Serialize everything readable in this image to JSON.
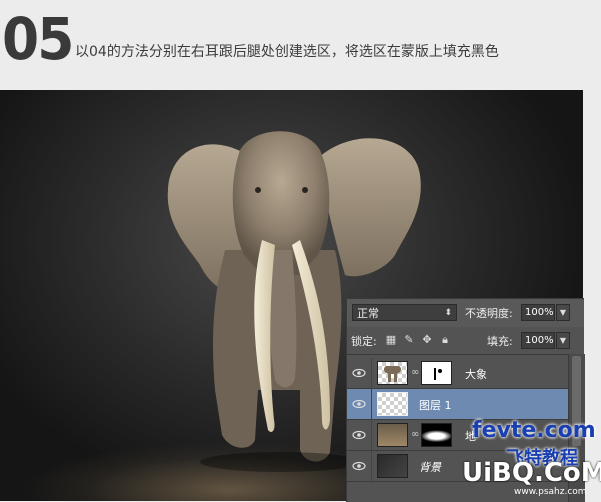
{
  "header": {
    "step_number": "05",
    "instruction": "以04的方法分别在右耳跟后腿处创建选区，将选区在蒙版上填充黑色"
  },
  "layers_panel": {
    "blend_mode": "正常",
    "opacity_label": "不透明度:",
    "opacity_value": "100%",
    "lock_label": "锁定:",
    "fill_label": "填充:",
    "fill_value": "100%",
    "layers": [
      {
        "name": "大象",
        "has_mask": true,
        "selected": false,
        "visible": true
      },
      {
        "name": "图层 1",
        "has_mask": false,
        "selected": true,
        "visible": true
      },
      {
        "name": "地",
        "has_mask": true,
        "selected": false,
        "visible": true
      },
      {
        "name": "背景",
        "has_mask": false,
        "selected": false,
        "visible": true
      }
    ]
  },
  "watermark": {
    "line1": "fevte.com",
    "line2": "飞特教程",
    "line3": "UiBQ.CoM",
    "line4": "www.psahz.com"
  },
  "colors": {
    "selected_layer": "#6e8ab0",
    "panel_bg": "#535353",
    "watermark_blue": "#1a3fb0"
  }
}
